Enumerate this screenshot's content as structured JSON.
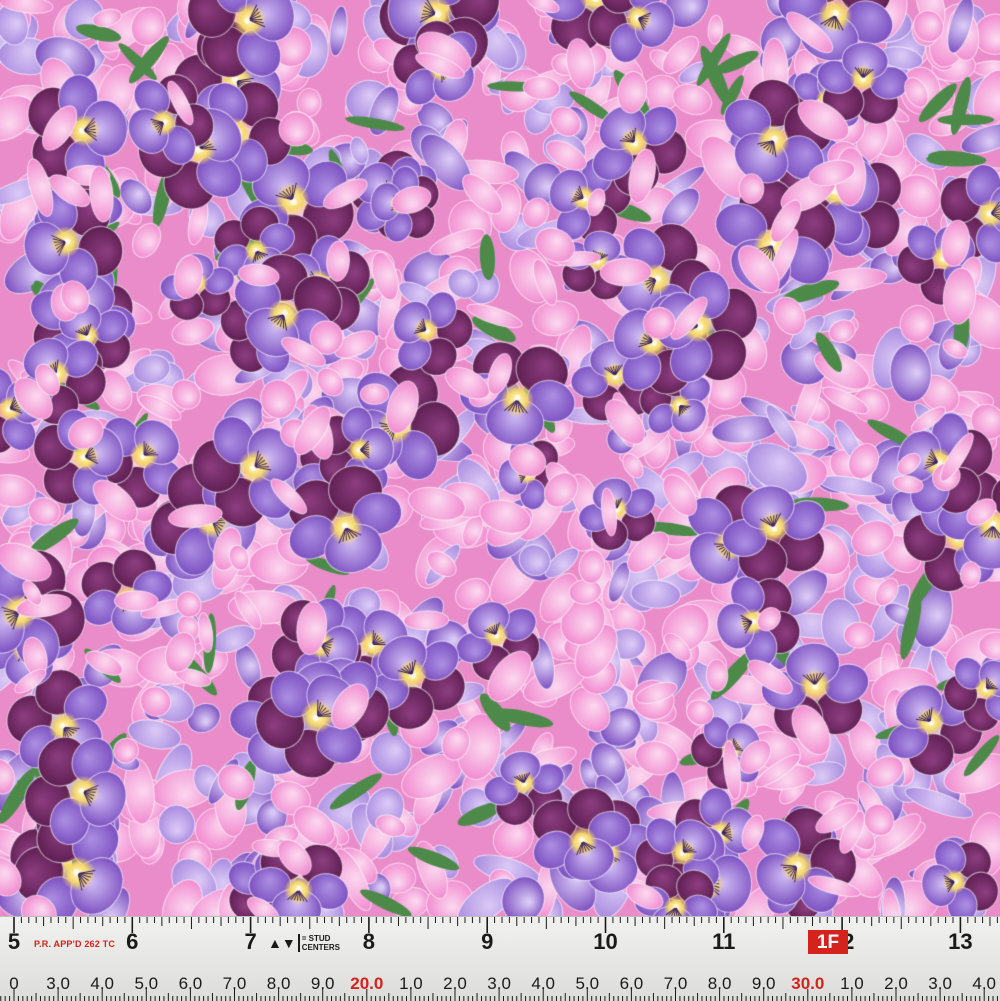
{
  "fabric": {
    "colors": {
      "base": "#e98cc9",
      "pink_petal": "#f28ad0",
      "pink_light": "#fbd4ee",
      "violet": "#7b4fc0",
      "violet_light": "#a98be0",
      "plum": "#5e1f52",
      "yellow_center": "#f6d96a",
      "leaf": "#4d8a4a"
    }
  },
  "ruler": {
    "inch_labels": [
      "5",
      "6",
      "7",
      "8",
      "9",
      "10",
      "11",
      "12",
      "13"
    ],
    "tenth_labels": [
      "0",
      "3.0",
      "4.0",
      "5.0",
      "6.0",
      "7.0",
      "8.0",
      "9.0",
      "20.0",
      "1.0",
      "2.0",
      "3.0",
      "4.0",
      "5.0",
      "6.0",
      "7.0",
      "8.0",
      "9.0",
      "30.0",
      "1.0",
      "2.0",
      "3.0",
      "4.0"
    ],
    "approved_text": "P.R. APP'D 262 TC",
    "stud_line1": "= STUD",
    "stud_line2": "CENTERS",
    "stud_arrows": "▲▼",
    "foot_badge": "1F",
    "red_color": "#d4231d"
  }
}
